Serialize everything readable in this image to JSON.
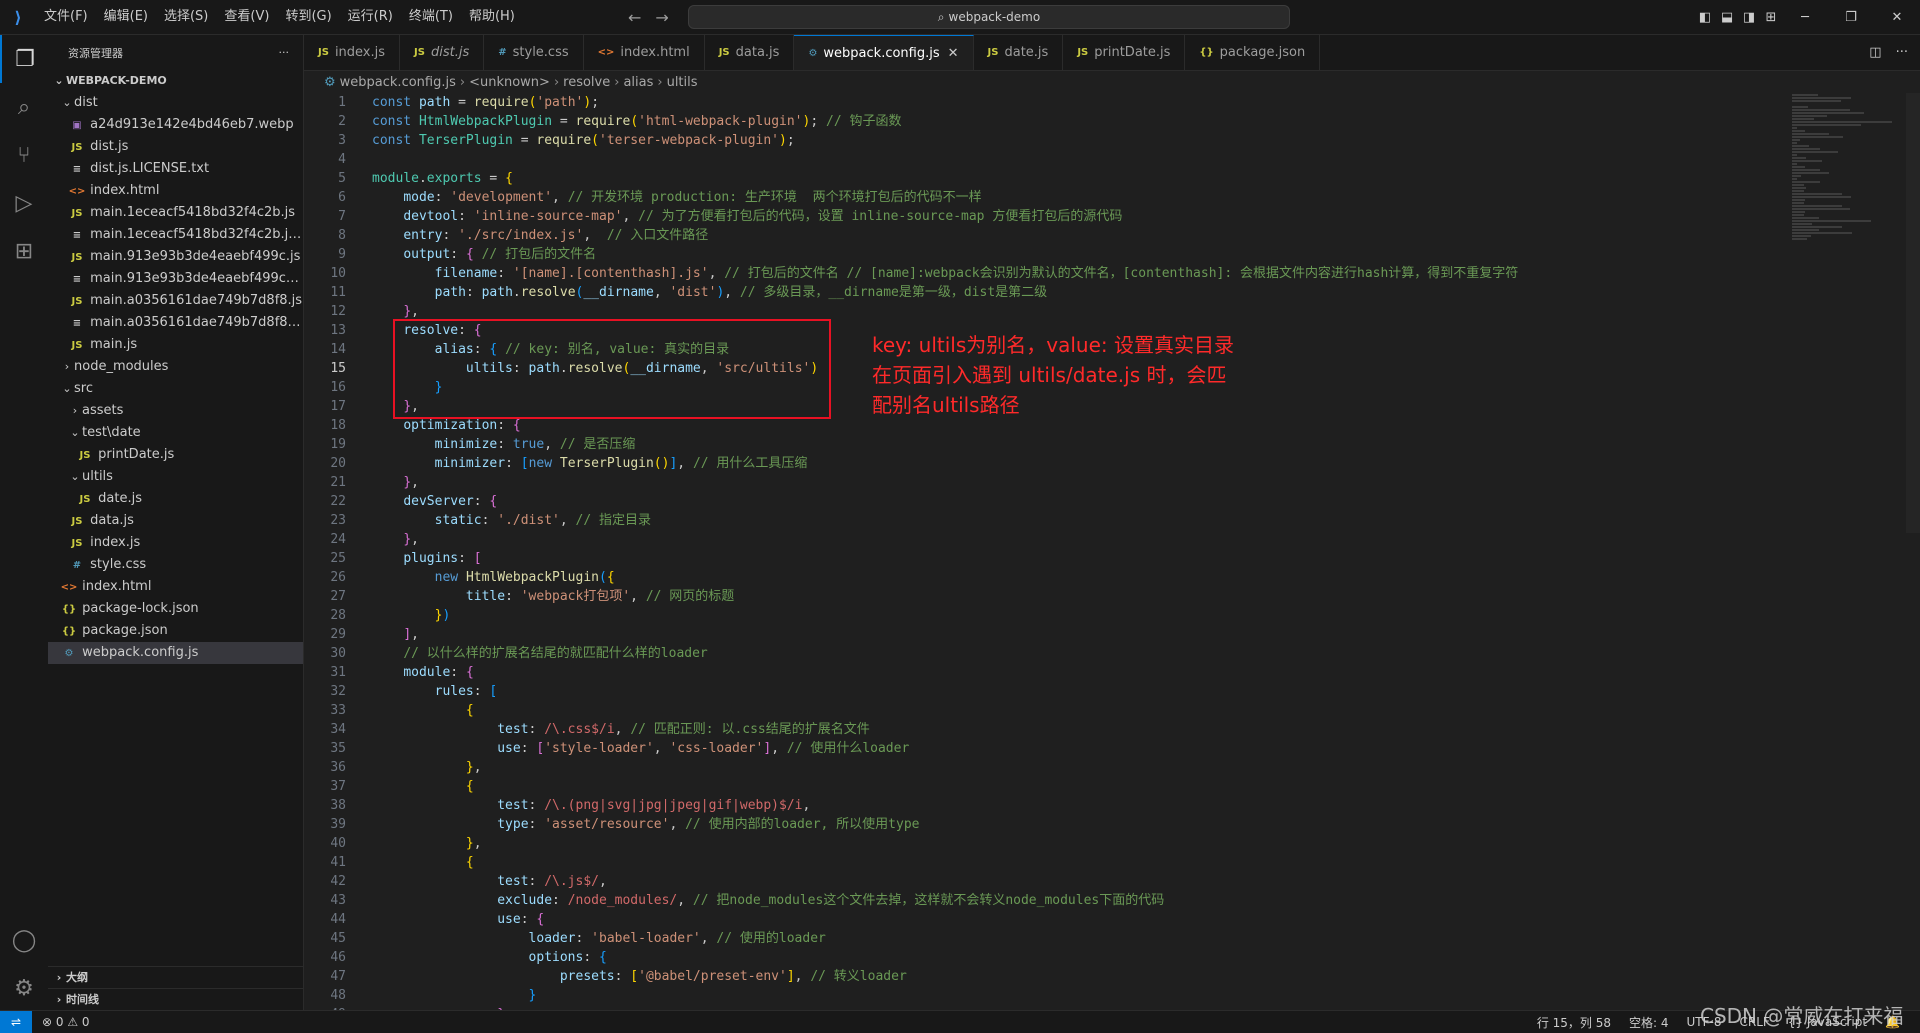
{
  "titlebar": {
    "menus": [
      "文件(F)",
      "编辑(E)",
      "选择(S)",
      "查看(V)",
      "转到(G)",
      "运行(R)",
      "终端(T)",
      "帮助(H)"
    ],
    "search_text": "webpack-demo"
  },
  "sidebar": {
    "title": "资源管理器",
    "more": "···",
    "root": "WEBPACK-DEMO",
    "items": [
      {
        "name": "dist",
        "type": "folder",
        "open": true,
        "depth": 1
      },
      {
        "name": "a24d913e142e4bd46eb7.webp",
        "type": "img",
        "depth": 2
      },
      {
        "name": "dist.js",
        "type": "js",
        "depth": 2
      },
      {
        "name": "dist.js.LICENSE.txt",
        "type": "txt",
        "depth": 2
      },
      {
        "name": "index.html",
        "type": "html",
        "depth": 2
      },
      {
        "name": "main.1eceacf5418bd32f4c2b.js",
        "type": "js",
        "depth": 2
      },
      {
        "name": "main.1eceacf5418bd32f4c2b.js.LICE...",
        "type": "txt",
        "depth": 2
      },
      {
        "name": "main.913e93b3de4eaebf499c.js",
        "type": "js",
        "depth": 2
      },
      {
        "name": "main.913e93b3de4eaebf499c.js.LIC...",
        "type": "txt",
        "depth": 2
      },
      {
        "name": "main.a0356161dae749b7d8f8.js",
        "type": "js",
        "depth": 2
      },
      {
        "name": "main.a0356161dae749b7d8f8.js.LIC...",
        "type": "txt",
        "depth": 2
      },
      {
        "name": "main.js",
        "type": "js",
        "depth": 2
      },
      {
        "name": "node_modules",
        "type": "folder",
        "open": false,
        "depth": 1
      },
      {
        "name": "src",
        "type": "folder",
        "open": true,
        "depth": 1
      },
      {
        "name": "assets",
        "type": "folder",
        "open": false,
        "depth": 2
      },
      {
        "name": "test\\date",
        "type": "folder",
        "open": true,
        "depth": 2
      },
      {
        "name": "printDate.js",
        "type": "js",
        "depth": 3
      },
      {
        "name": "ultils",
        "type": "folder",
        "open": true,
        "depth": 2
      },
      {
        "name": "date.js",
        "type": "js",
        "depth": 3
      },
      {
        "name": "data.js",
        "type": "js",
        "depth": 2
      },
      {
        "name": "index.js",
        "type": "js",
        "depth": 2
      },
      {
        "name": "style.css",
        "type": "css",
        "depth": 2
      },
      {
        "name": "index.html",
        "type": "html",
        "depth": 1
      },
      {
        "name": "package-lock.json",
        "type": "json",
        "depth": 1
      },
      {
        "name": "package.json",
        "type": "json",
        "depth": 1
      },
      {
        "name": "webpack.config.js",
        "type": "cfg",
        "depth": 1,
        "selected": true
      }
    ],
    "outline": "大纲",
    "timeline": "时间线"
  },
  "icons": {
    "js": "JS",
    "html": "<>",
    "css": "#",
    "json": "{}",
    "txt": "≡",
    "img": "▣",
    "cfg": "⚙"
  },
  "tabs": [
    {
      "label": "index.js",
      "type": "js"
    },
    {
      "label": "dist.js",
      "type": "js",
      "italic": true
    },
    {
      "label": "style.css",
      "type": "css"
    },
    {
      "label": "index.html",
      "type": "html"
    },
    {
      "label": "data.js",
      "type": "js"
    },
    {
      "label": "webpack.config.js",
      "type": "cfg",
      "active": true
    },
    {
      "label": "date.js",
      "type": "js"
    },
    {
      "label": "printDate.js",
      "type": "js"
    },
    {
      "label": "package.json",
      "type": "json"
    }
  ],
  "breadcrumb": [
    "webpack.config.js",
    "<unknown>",
    "resolve",
    "alias",
    "ultils"
  ],
  "editor": {
    "current_line": 15,
    "lines": [
      [
        [
          "kw",
          "const "
        ],
        [
          "var",
          "path"
        ],
        [
          "plain",
          " = "
        ],
        [
          "fn",
          "require"
        ],
        [
          "br1",
          "("
        ],
        [
          "str",
          "'path'"
        ],
        [
          "br1",
          ")"
        ],
        [
          "plain",
          ";"
        ]
      ],
      [
        [
          "kw",
          "const "
        ],
        [
          "cls",
          "HtmlWebpackPlugin"
        ],
        [
          "plain",
          " = "
        ],
        [
          "fn",
          "require"
        ],
        [
          "br1",
          "("
        ],
        [
          "str",
          "'html-webpack-plugin'"
        ],
        [
          "br1",
          ")"
        ],
        [
          "plain",
          "; "
        ],
        [
          "cm",
          "// 钩子函数"
        ]
      ],
      [
        [
          "kw",
          "const "
        ],
        [
          "cls",
          "TerserPlugin"
        ],
        [
          "plain",
          " = "
        ],
        [
          "fn",
          "require"
        ],
        [
          "br1",
          "("
        ],
        [
          "str",
          "'terser-webpack-plugin'"
        ],
        [
          "br1",
          ")"
        ],
        [
          "plain",
          ";"
        ]
      ],
      [],
      [
        [
          "cls",
          "module"
        ],
        [
          "plain",
          "."
        ],
        [
          "cls",
          "exports"
        ],
        [
          "plain",
          " = "
        ],
        [
          "br1",
          "{"
        ]
      ],
      [
        [
          "plain",
          "    "
        ],
        [
          "var",
          "mode"
        ],
        [
          "plain",
          ": "
        ],
        [
          "str",
          "'development'"
        ],
        [
          "plain",
          ", "
        ],
        [
          "cm",
          "// 开发环境 production: 生产环境  两个环境打包后的代码不一样"
        ]
      ],
      [
        [
          "plain",
          "    "
        ],
        [
          "var",
          "devtool"
        ],
        [
          "plain",
          ": "
        ],
        [
          "str",
          "'inline-source-map'"
        ],
        [
          "plain",
          ", "
        ],
        [
          "cm",
          "// 为了方便看打包后的代码，设置 inline-source-map 方便看打包后的源代码"
        ]
      ],
      [
        [
          "plain",
          "    "
        ],
        [
          "var",
          "entry"
        ],
        [
          "plain",
          ": "
        ],
        [
          "str",
          "'./src/index.js'"
        ],
        [
          "plain",
          ",  "
        ],
        [
          "cm",
          "// 入口文件路径"
        ]
      ],
      [
        [
          "plain",
          "    "
        ],
        [
          "var",
          "output"
        ],
        [
          "plain",
          ": "
        ],
        [
          "br2",
          "{"
        ],
        [
          "plain",
          " "
        ],
        [
          "cm",
          "// 打包后的文件名"
        ]
      ],
      [
        [
          "plain",
          "        "
        ],
        [
          "var",
          "filename"
        ],
        [
          "plain",
          ": "
        ],
        [
          "str",
          "'[name].[contenthash].js'"
        ],
        [
          "plain",
          ", "
        ],
        [
          "cm",
          "// 打包后的文件名 // [name]:webpack会识别为默认的文件名，[contenthash]: 会根据文件内容进行hash计算，得到不重复字符"
        ]
      ],
      [
        [
          "plain",
          "        "
        ],
        [
          "var",
          "path"
        ],
        [
          "plain",
          ": "
        ],
        [
          "var",
          "path"
        ],
        [
          "plain",
          "."
        ],
        [
          "fn",
          "resolve"
        ],
        [
          "br3",
          "("
        ],
        [
          "var",
          "__dirname"
        ],
        [
          "plain",
          ", "
        ],
        [
          "str",
          "'dist'"
        ],
        [
          "br3",
          ")"
        ],
        [
          "plain",
          ", "
        ],
        [
          "cm",
          "// 多级目录，__dirname是第一级，dist是第二级"
        ]
      ],
      [
        [
          "plain",
          "    "
        ],
        [
          "br2",
          "}"
        ],
        [
          "plain",
          ","
        ]
      ],
      [
        [
          "plain",
          "    "
        ],
        [
          "var",
          "resolve"
        ],
        [
          "plain",
          ": "
        ],
        [
          "br2",
          "{"
        ]
      ],
      [
        [
          "plain",
          "        "
        ],
        [
          "var",
          "alias"
        ],
        [
          "plain",
          ": "
        ],
        [
          "br3",
          "{"
        ],
        [
          "plain",
          " "
        ],
        [
          "cm",
          "// key: 别名, value: 真实的目录"
        ]
      ],
      [
        [
          "plain",
          "            "
        ],
        [
          "var",
          "ultils"
        ],
        [
          "plain",
          ": "
        ],
        [
          "var",
          "path"
        ],
        [
          "plain",
          "."
        ],
        [
          "fn",
          "resolve"
        ],
        [
          "br1",
          "("
        ],
        [
          "var",
          "__dirname"
        ],
        [
          "plain",
          ", "
        ],
        [
          "str",
          "'src/ultils'"
        ],
        [
          "br1",
          ")"
        ]
      ],
      [
        [
          "plain",
          "        "
        ],
        [
          "br3",
          "}"
        ]
      ],
      [
        [
          "plain",
          "    "
        ],
        [
          "br2",
          "}"
        ],
        [
          "plain",
          ","
        ]
      ],
      [
        [
          "plain",
          "    "
        ],
        [
          "var",
          "optimization"
        ],
        [
          "plain",
          ": "
        ],
        [
          "br2",
          "{"
        ]
      ],
      [
        [
          "plain",
          "        "
        ],
        [
          "var",
          "minimize"
        ],
        [
          "plain",
          ": "
        ],
        [
          "kw",
          "true"
        ],
        [
          "plain",
          ", "
        ],
        [
          "cm",
          "// 是否压缩"
        ]
      ],
      [
        [
          "plain",
          "        "
        ],
        [
          "var",
          "minimizer"
        ],
        [
          "plain",
          ": "
        ],
        [
          "br3",
          "["
        ],
        [
          "kw",
          "new "
        ],
        [
          "fn",
          "TerserPlugin"
        ],
        [
          "br1",
          "()"
        ],
        [
          "br3",
          "]"
        ],
        [
          "plain",
          ", "
        ],
        [
          "cm",
          "// 用什么工具压缩"
        ]
      ],
      [
        [
          "plain",
          "    "
        ],
        [
          "br2",
          "}"
        ],
        [
          "plain",
          ","
        ]
      ],
      [
        [
          "plain",
          "    "
        ],
        [
          "var",
          "devServer"
        ],
        [
          "plain",
          ": "
        ],
        [
          "br2",
          "{"
        ]
      ],
      [
        [
          "plain",
          "        "
        ],
        [
          "var",
          "static"
        ],
        [
          "plain",
          ": "
        ],
        [
          "str",
          "'./dist'"
        ],
        [
          "plain",
          ", "
        ],
        [
          "cm",
          "// 指定目录"
        ]
      ],
      [
        [
          "plain",
          "    "
        ],
        [
          "br2",
          "}"
        ],
        [
          "plain",
          ","
        ]
      ],
      [
        [
          "plain",
          "    "
        ],
        [
          "var",
          "plugins"
        ],
        [
          "plain",
          ": "
        ],
        [
          "br2",
          "["
        ]
      ],
      [
        [
          "plain",
          "        "
        ],
        [
          "kw",
          "new "
        ],
        [
          "fn",
          "HtmlWebpackPlugin"
        ],
        [
          "br3",
          "("
        ],
        [
          "br1",
          "{"
        ]
      ],
      [
        [
          "plain",
          "            "
        ],
        [
          "var",
          "title"
        ],
        [
          "plain",
          ": "
        ],
        [
          "str",
          "'webpack打包项'"
        ],
        [
          "plain",
          ", "
        ],
        [
          "cm",
          "// 网页的标题"
        ]
      ],
      [
        [
          "plain",
          "        "
        ],
        [
          "br1",
          "}"
        ],
        [
          "br3",
          ")"
        ]
      ],
      [
        [
          "plain",
          "    "
        ],
        [
          "br2",
          "]"
        ],
        [
          "plain",
          ","
        ]
      ],
      [
        [
          "plain",
          "    "
        ],
        [
          "cm",
          "// 以什么样的扩展名结尾的就匹配什么样的loader"
        ]
      ],
      [
        [
          "plain",
          "    "
        ],
        [
          "var",
          "module"
        ],
        [
          "plain",
          ": "
        ],
        [
          "br2",
          "{"
        ]
      ],
      [
        [
          "plain",
          "        "
        ],
        [
          "var",
          "rules"
        ],
        [
          "plain",
          ": "
        ],
        [
          "br3",
          "["
        ]
      ],
      [
        [
          "plain",
          "            "
        ],
        [
          "br1",
          "{"
        ]
      ],
      [
        [
          "plain",
          "                "
        ],
        [
          "var",
          "test"
        ],
        [
          "plain",
          ": "
        ],
        [
          "rx",
          "/\\.css$/i"
        ],
        [
          "plain",
          ", "
        ],
        [
          "cm",
          "// 匹配正则: 以.css结尾的扩展名文件"
        ]
      ],
      [
        [
          "plain",
          "                "
        ],
        [
          "var",
          "use"
        ],
        [
          "plain",
          ": "
        ],
        [
          "br2",
          "["
        ],
        [
          "str",
          "'style-loader'"
        ],
        [
          "plain",
          ", "
        ],
        [
          "str",
          "'css-loader'"
        ],
        [
          "br2",
          "]"
        ],
        [
          "plain",
          ", "
        ],
        [
          "cm",
          "// 使用什么loader"
        ]
      ],
      [
        [
          "plain",
          "            "
        ],
        [
          "br1",
          "}"
        ],
        [
          "plain",
          ","
        ]
      ],
      [
        [
          "plain",
          "            "
        ],
        [
          "br1",
          "{"
        ]
      ],
      [
        [
          "plain",
          "                "
        ],
        [
          "var",
          "test"
        ],
        [
          "plain",
          ": "
        ],
        [
          "rx",
          "/\\.(png|svg|jpg|jpeg|gif|webp)$/i"
        ],
        [
          "plain",
          ","
        ]
      ],
      [
        [
          "plain",
          "                "
        ],
        [
          "var",
          "type"
        ],
        [
          "plain",
          ": "
        ],
        [
          "str",
          "'asset/resource'"
        ],
        [
          "plain",
          ", "
        ],
        [
          "cm",
          "// 使用内部的loader, 所以使用type"
        ]
      ],
      [
        [
          "plain",
          "            "
        ],
        [
          "br1",
          "}"
        ],
        [
          "plain",
          ","
        ]
      ],
      [
        [
          "plain",
          "            "
        ],
        [
          "br1",
          "{"
        ]
      ],
      [
        [
          "plain",
          "                "
        ],
        [
          "var",
          "test"
        ],
        [
          "plain",
          ": "
        ],
        [
          "rx",
          "/\\.js$/"
        ],
        [
          "plain",
          ","
        ]
      ],
      [
        [
          "plain",
          "                "
        ],
        [
          "var",
          "exclude"
        ],
        [
          "plain",
          ": "
        ],
        [
          "rx",
          "/node_modules/"
        ],
        [
          "plain",
          ", "
        ],
        [
          "cm",
          "// 把node_modules这个文件去掉，这样就不会转义node_modules下面的代码"
        ]
      ],
      [
        [
          "plain",
          "                "
        ],
        [
          "var",
          "use"
        ],
        [
          "plain",
          ": "
        ],
        [
          "br2",
          "{"
        ]
      ],
      [
        [
          "plain",
          "                    "
        ],
        [
          "var",
          "loader"
        ],
        [
          "plain",
          ": "
        ],
        [
          "str",
          "'babel-loader'"
        ],
        [
          "plain",
          ", "
        ],
        [
          "cm",
          "// 使用的loader"
        ]
      ],
      [
        [
          "plain",
          "                    "
        ],
        [
          "var",
          "options"
        ],
        [
          "plain",
          ": "
        ],
        [
          "br3",
          "{"
        ]
      ],
      [
        [
          "plain",
          "                        "
        ],
        [
          "var",
          "presets"
        ],
        [
          "plain",
          ": "
        ],
        [
          "br1",
          "["
        ],
        [
          "str",
          "'@babel/preset-env'"
        ],
        [
          "br1",
          "]"
        ],
        [
          "plain",
          ", "
        ],
        [
          "cm",
          "// 转义loader"
        ]
      ],
      [
        [
          "plain",
          "                    "
        ],
        [
          "br3",
          "}"
        ]
      ],
      [
        [
          "plain",
          "                "
        ],
        [
          "br2",
          "}"
        ]
      ]
    ]
  },
  "annotation": {
    "line1": "key: ultils为别名，value: 设置真实目录",
    "line2": "在页面引入遇到 ultils/date.js 时，会匹",
    "line3": "配别名ultils路径"
  },
  "statusbar": {
    "problems": "⊗ 0 ⚠ 0",
    "position": "行 15，列 58",
    "spaces": "空格: 4",
    "encoding": "UTF-8",
    "eol": "CRLF",
    "language": "{} JavaScript"
  },
  "watermark": "CSDN @常威在打来福"
}
